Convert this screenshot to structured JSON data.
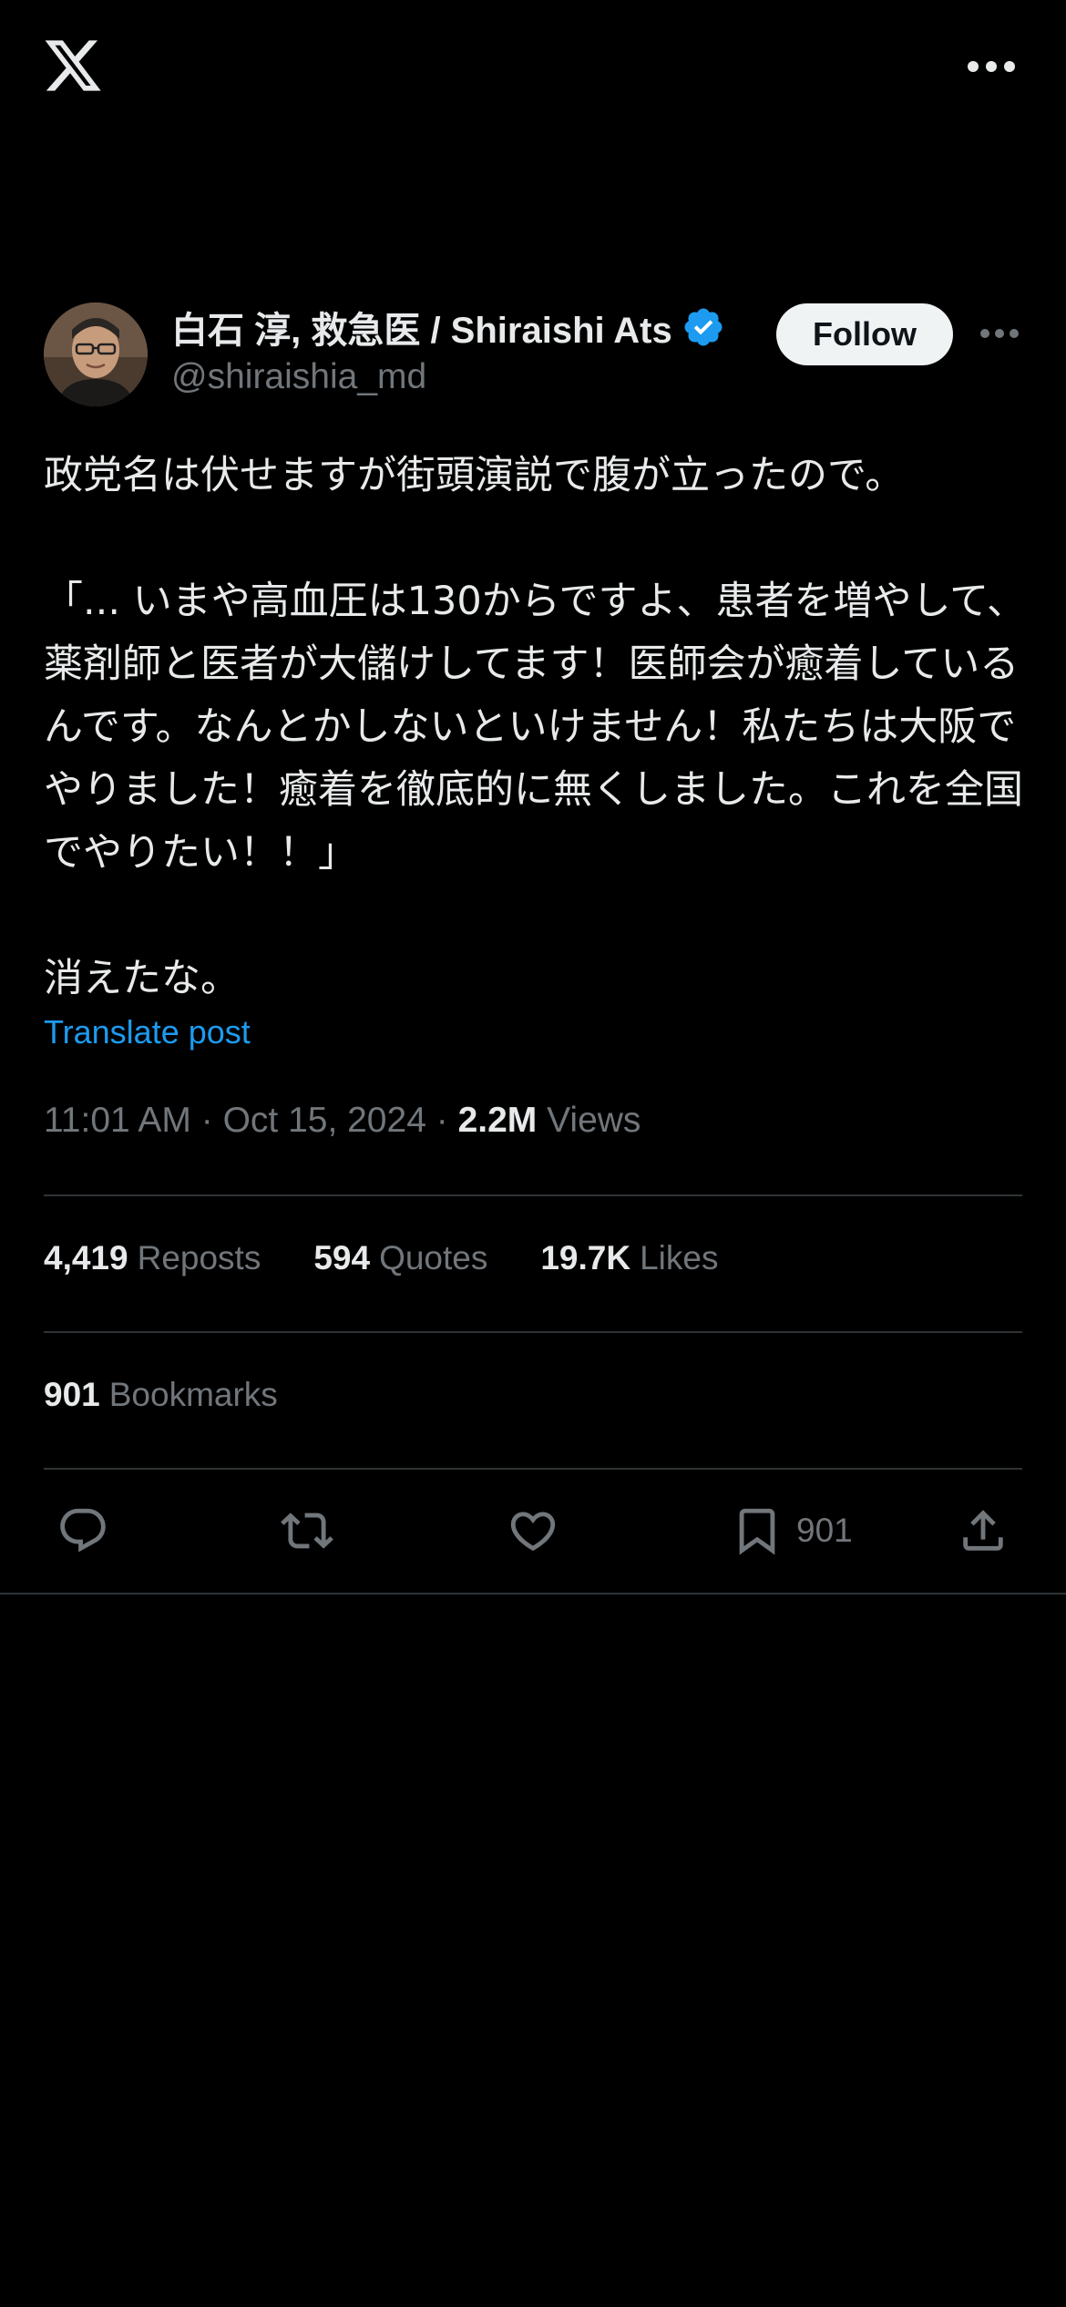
{
  "author": {
    "display_name": "白石 淳, 救急医 / Shiraishi Ats",
    "handle": "@shiraishia_md",
    "follow_label": "Follow",
    "verified": true
  },
  "post": {
    "text": "政党名は伏せますが街頭演説で腹が立ったので。\n\n「... いまや高血圧は130からですよ、患者を増やして、薬剤師と医者が大儲けしてます！医師会が癒着しているんです。なんとかしないといけません！私たちは大阪でやりました！癒着を徹底的に無くしました。これを全国でやりたい！！」\n\n消えたな。",
    "translate_label": "Translate post",
    "time": "11:01 AM",
    "date": "Oct 15, 2024",
    "separator": " · ",
    "views_count": "2.2M",
    "views_label": "Views"
  },
  "stats": {
    "reposts_count": "4,419",
    "reposts_label": "Reposts",
    "quotes_count": "594",
    "quotes_label": "Quotes",
    "likes_count": "19.7K",
    "likes_label": "Likes",
    "bookmarks_count": "901",
    "bookmarks_label": "Bookmarks"
  },
  "actions": {
    "bookmark_count": "901"
  },
  "icons": {
    "logo": "x-logo-icon",
    "more": "more-icon",
    "verified": "verified-badge-icon",
    "reply": "reply-icon",
    "repost": "repost-icon",
    "like": "heart-icon",
    "bookmark": "bookmark-icon",
    "share": "share-icon"
  },
  "colors": {
    "background": "#000000",
    "text": "#e7e9ea",
    "secondary": "#71767b",
    "accent": "#1d9bf0",
    "divider": "#2f3336"
  }
}
